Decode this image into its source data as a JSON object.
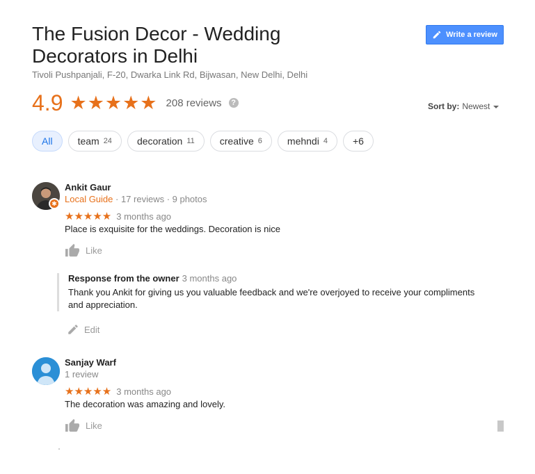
{
  "place": {
    "title": "The Fusion Decor - Wedding Decorators in Delhi",
    "address": "Tivoli Pushpanjali, F-20, Dwarka Link Rd, Bijwasan, New Delhi, Delhi",
    "rating": "4.9",
    "stars": "★★★★★",
    "review_count": "208 reviews",
    "help_icon": "?"
  },
  "write_review": {
    "label": "Write a review",
    "icon": "pencil-icon"
  },
  "sort": {
    "label": "Sort by:",
    "value": "Newest"
  },
  "chips": [
    {
      "label": "All",
      "count": ""
    },
    {
      "label": "team",
      "count": "24"
    },
    {
      "label": "decoration",
      "count": "11"
    },
    {
      "label": "creative",
      "count": "6"
    },
    {
      "label": "mehndi",
      "count": "4"
    },
    {
      "label": "+6",
      "count": ""
    }
  ],
  "reviews": [
    {
      "name": "Ankit Gaur",
      "guide": "Local Guide",
      "meta": " · 17 reviews · 9 photos",
      "stars": "★★★★★",
      "when": "3 months ago",
      "text": "Place is exquisite for the weddings. Decoration is nice",
      "like_label": "Like",
      "owner_response": {
        "heading": "Response from the owner",
        "when": "3 months ago",
        "text": "Thank you Ankit for giving us you valuable feedback and we're overjoyed to receive your compliments and appreciation.",
        "edit_label": "Edit"
      }
    },
    {
      "name": "Sanjay Warf",
      "meta": "1 review",
      "stars": "★★★★★",
      "when": "3 months ago",
      "text": "The decoration was amazing and lovely.",
      "like_label": "Like"
    }
  ],
  "colors": {
    "accent": "#e7711b",
    "button": "#4d90fe",
    "chip_active_bg": "#e8f0fe"
  }
}
